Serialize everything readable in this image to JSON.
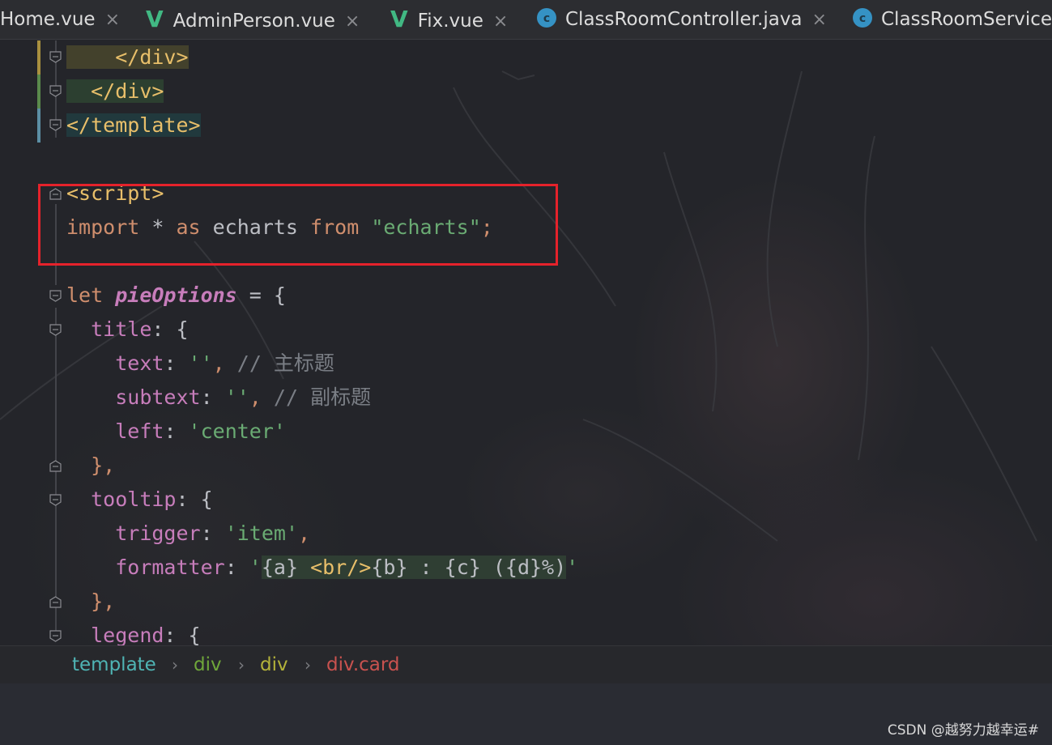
{
  "tabs": [
    {
      "label": "Home.vue",
      "icon": "none",
      "close": "×"
    },
    {
      "label": "AdminPerson.vue",
      "icon": "vue-icon",
      "glyph": "V",
      "close": "×"
    },
    {
      "label": "Fix.vue",
      "icon": "vue-icon",
      "glyph": "V",
      "close": "×"
    },
    {
      "label": "ClassRoomController.java",
      "icon": "java-class-icon",
      "glyph": "c",
      "close": "×"
    },
    {
      "label": "ClassRoomService.",
      "icon": "java-class-icon",
      "glyph": "c"
    }
  ],
  "code": {
    "l1": {
      "tag": "</div>"
    },
    "l2": {
      "tag": "</div>"
    },
    "l3": {
      "tag": "</template>"
    },
    "l5": {
      "tag": "<script>"
    },
    "l6": {
      "kw1": "import",
      "p1": " * ",
      "kw2": "as",
      "p2": " echarts ",
      "kw3": "from",
      "p3": " ",
      "str": "\"echarts\"",
      "semi": ";"
    },
    "l8": {
      "kw": "let",
      "name": "pieOptions",
      "rest": " = {"
    },
    "l9": {
      "prop": "title",
      "rest": ": {"
    },
    "l10": {
      "prop": "text",
      "colon": ": ",
      "str": "''",
      "comma": ",",
      "comment": " // 主标题"
    },
    "l11": {
      "prop": "subtext",
      "colon": ": ",
      "str": "''",
      "comma": ",",
      "comment": " // 副标题"
    },
    "l12": {
      "prop": "left",
      "colon": ": ",
      "str": "'center'"
    },
    "l13": {
      "rest": "},"
    },
    "l14": {
      "prop": "tooltip",
      "rest": ": {"
    },
    "l15": {
      "prop": "trigger",
      "colon": ": ",
      "str": "'item'",
      "comma": ","
    },
    "l16": {
      "prop": "formatter",
      "colon": ": ",
      "q1": "'",
      "t1": "{a} ",
      "t2": "<br/>",
      "t3": "{b} : {c} ({d}%)",
      "q2": "'"
    },
    "l17": {
      "rest": "},"
    },
    "l18": {
      "prop": "legend",
      "rest": ": {"
    }
  },
  "breadcrumb": [
    "template",
    "div",
    "div",
    "div.card"
  ],
  "breadcrumb_separator": "›",
  "colors": {
    "background": "#24252a",
    "tag": "#e8bf6a",
    "keyword": "#cf8e6d",
    "property": "#c77dbb",
    "string": "#6aab73",
    "comment": "#7a7e85",
    "highlight_box": "#e5222b"
  },
  "watermark": "CSDN @越努力越幸运#"
}
